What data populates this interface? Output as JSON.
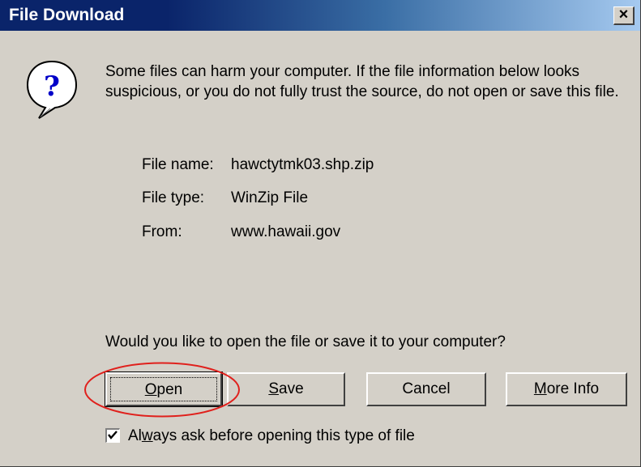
{
  "window": {
    "title": "File Download",
    "close_glyph": "×"
  },
  "message": {
    "icon": "question-icon",
    "warning": "Some files can harm your computer. If the file information below looks suspicious, or you do not fully trust the source, do not open or save this file."
  },
  "file_info": {
    "name_label": "File name:",
    "name_value": "hawctytmk03.shp.zip",
    "type_label": "File type:",
    "type_value": "WinZip File",
    "from_label": "From:",
    "from_value": "www.hawaii.gov"
  },
  "prompt": {
    "question": "Would you like to open the file or save it to your computer?"
  },
  "buttons": {
    "open_first": "O",
    "open_rest": "pen",
    "save_first": "S",
    "save_rest": "ave",
    "cancel": "Cancel",
    "more_first": "M",
    "more_rest": "ore Info"
  },
  "checkbox": {
    "checked": true,
    "label_prefix": "Al",
    "label_accel": "w",
    "label_suffix": "ays ask before opening this type of file"
  },
  "colors": {
    "title_bar": "#0a246a",
    "dialog_bg": "#d4d0c8",
    "annotation": "#e0201c"
  }
}
